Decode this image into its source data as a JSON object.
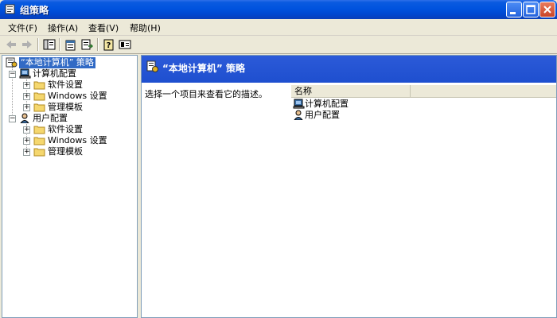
{
  "window": {
    "title": "组策略"
  },
  "menu": [
    "文件(F)",
    "操作(A)",
    "查看(V)",
    "帮助(H)"
  ],
  "toolbar": [
    "back-icon",
    "forward-icon",
    "show-hide-tree-icon",
    "properties-icon",
    "export-list-icon",
    "help-icon",
    "console-icon"
  ],
  "tree": {
    "root": "“本地计算机” 策略",
    "computer_config": "计算机配置",
    "user_config": "用户配置",
    "software_settings": "软件设置",
    "windows_settings": "Windows 设置",
    "admin_templates": "管理模板"
  },
  "right": {
    "header_title": "“本地计算机” 策略",
    "description": "选择一个项目来查看它的描述。",
    "column_name": "名称",
    "items": [
      "计算机配置",
      "用户配置"
    ]
  },
  "colors": {
    "titlebar": "#0053de",
    "selection": "#316ac5",
    "header": "#1e4fcf"
  }
}
